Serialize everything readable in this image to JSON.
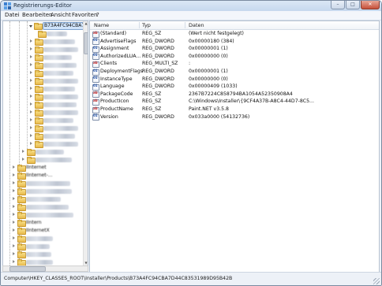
{
  "window": {
    "title": "Registrierungs-Editor",
    "controls": {
      "minimize": "–",
      "maximize": "□",
      "close": "✕"
    }
  },
  "menu": [
    "Datei",
    "Bearbeiten",
    "Ansicht",
    "Favoriten",
    "?"
  ],
  "tree": {
    "selected_key": "B73A4FC94CBA7D",
    "visible_labels": [
      "IInternet",
      "IInternet-...",
      "IIntern",
      "IInternetX"
    ]
  },
  "columns": {
    "name": "Name",
    "type": "Typ",
    "data": "Daten"
  },
  "values": [
    {
      "name": "(Standard)",
      "type": "REG_SZ",
      "data": "(Wert nicht festgelegt)",
      "icon": "string-value-icon"
    },
    {
      "name": "AdvertiseFlags",
      "type": "REG_DWORD",
      "data": "0x00000180 (384)",
      "icon": "binary-value-icon"
    },
    {
      "name": "Assignment",
      "type": "REG_DWORD",
      "data": "0x00000001 (1)",
      "icon": "binary-value-icon"
    },
    {
      "name": "AuthorizedLUA...",
      "type": "REG_DWORD",
      "data": "0x00000000 (0)",
      "icon": "binary-value-icon"
    },
    {
      "name": "Clients",
      "type": "REG_MULTI_SZ",
      "data": ":",
      "icon": "string-value-icon"
    },
    {
      "name": "DeploymentFlags",
      "type": "REG_DWORD",
      "data": "0x00000001 (1)",
      "icon": "binary-value-icon"
    },
    {
      "name": "InstanceType",
      "type": "REG_DWORD",
      "data": "0x00000000 (0)",
      "icon": "binary-value-icon"
    },
    {
      "name": "Language",
      "type": "REG_DWORD",
      "data": "0x00000409 (1033)",
      "icon": "binary-value-icon"
    },
    {
      "name": "PackageCode",
      "type": "REG_SZ",
      "data": "2367B7224C858794BA1054A52350908A4",
      "icon": "string-value-icon"
    },
    {
      "name": "ProductIcon",
      "type": "REG_SZ",
      "data": "C:\\Windows\\Installer\\{9CF4A37B-A8C4-44D7-8C5...",
      "icon": "string-value-icon"
    },
    {
      "name": "ProductName",
      "type": "REG_SZ",
      "data": "Paint.NET v3.5.8",
      "icon": "string-value-icon"
    },
    {
      "name": "Version",
      "type": "REG_DWORD",
      "data": "0x033a0000 (54132736)",
      "icon": "binary-value-icon"
    }
  ],
  "status": {
    "path": "Computer\\HKEY_CLASSES_ROOT\\Installer\\Products\\B73A4FC94CBA7D44C83531989D95B42B"
  },
  "colors": {
    "accent": "#cfe3fa",
    "folder": "#e8b94a",
    "window_frame": "#7a8aa0"
  }
}
